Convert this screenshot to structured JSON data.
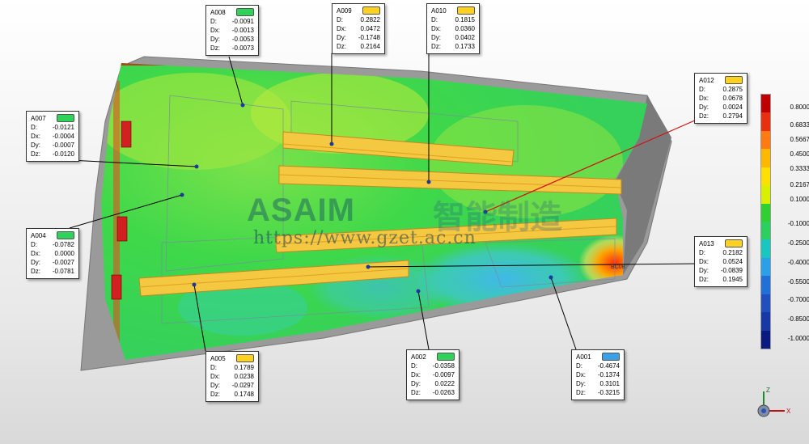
{
  "legend": {
    "ticks": [
      "0.8000",
      "0.6833",
      "0.5667",
      "0.4500",
      "0.3333",
      "0.2167",
      "0.1000",
      "-0.1000",
      "-0.2500",
      "-0.4000",
      "-0.5500",
      "-0.7000",
      "-0.8500",
      "-1.0000"
    ],
    "colors": [
      "#c00000",
      "#e83010",
      "#ff7a10",
      "#ffb800",
      "#ffe000",
      "#d9f000",
      "#30d030",
      "#2ad060",
      "#18c8c0",
      "#2aa0e8",
      "#2070d8",
      "#2050c0",
      "#1838a8",
      "#0a1a80"
    ]
  },
  "callouts": [
    {
      "id": "A008",
      "status": "green",
      "D": "-0.0091",
      "Dx": "-0.0013",
      "Dy": "-0.0053",
      "Dz": "-0.0073"
    },
    {
      "id": "A009",
      "status": "yellow",
      "D": "0.2822",
      "Dx": "0.0472",
      "Dy": "-0.1748",
      "Dz": "0.2164"
    },
    {
      "id": "A010",
      "status": "yellow",
      "D": "0.1815",
      "Dx": "0.0360",
      "Dy": "0.0402",
      "Dz": "0.1733"
    },
    {
      "id": "A012",
      "status": "yellow",
      "D": "0.2875",
      "Dx": "0.0678",
      "Dy": "0.0024",
      "Dz": "0.2794"
    },
    {
      "id": "A007",
      "status": "green",
      "D": "-0.0121",
      "Dx": "-0.0004",
      "Dy": "-0.0007",
      "Dz": "-0.0120"
    },
    {
      "id": "A004",
      "status": "green",
      "D": "-0.0782",
      "Dx": "0.0000",
      "Dy": "-0.0027",
      "Dz": "-0.0781"
    },
    {
      "id": "A013",
      "status": "yellow",
      "D": "0.2182",
      "Dx": "0.0524",
      "Dy": "-0.0839",
      "Dz": "0.1945"
    },
    {
      "id": "A005",
      "status": "yellow",
      "D": "0.1789",
      "Dx": "0.0238",
      "Dy": "-0.0297",
      "Dz": "0.1748"
    },
    {
      "id": "A002",
      "status": "green",
      "D": "-0.0358",
      "Dx": "-0.0097",
      "Dy": "0.0222",
      "Dz": "-0.0263"
    },
    {
      "id": "A001",
      "status": "blue",
      "D": "-0.4674",
      "Dx": "-0.1374",
      "Dy": "0.3101",
      "Dz": "-0.3215"
    }
  ],
  "labels": {
    "d": "D:",
    "dx": "Dx:",
    "dy": "Dy:",
    "dz": "Dz:"
  },
  "status_colors": {
    "green": "#2fd35a",
    "yellow": "#ffd21f",
    "blue": "#3aa0e8"
  },
  "watermark": {
    "logo": "ASAIM",
    "cn": "智能制造",
    "url": "https://www.gzet.ac.cn"
  },
  "part_label": "BC08",
  "triad": {
    "z": "Z",
    "x": "X"
  }
}
